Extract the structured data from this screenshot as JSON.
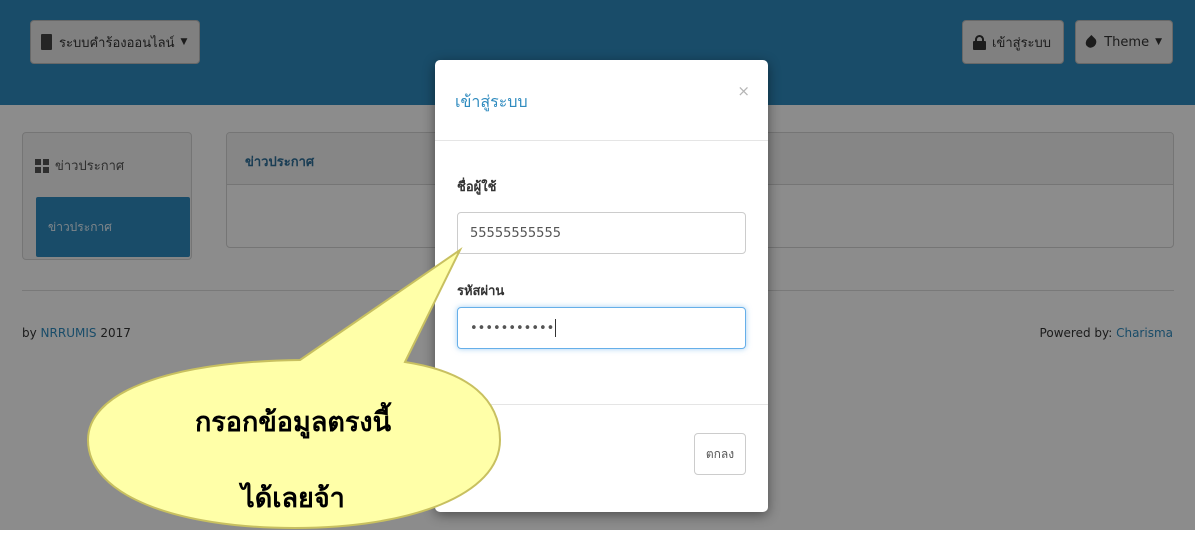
{
  "navbar": {
    "brand_label": "ระบบคำร้องออนไลน์",
    "login_label": "เข้าสู่ระบบ",
    "theme_label": "Theme",
    "color": "#2f8bbf"
  },
  "sidebar": {
    "heading": "ข่าวประกาศ",
    "active_item": "ข่าวประกาศ"
  },
  "main": {
    "panel_title": "ข่าวประกาศ"
  },
  "footer": {
    "prefix": "by ",
    "org_link": "NRRUMIS",
    "year": " 2017",
    "powered_prefix": "Powered by: ",
    "powered_link": "Charisma"
  },
  "modal": {
    "title": "เข้าสู่ระบบ",
    "close_symbol": "×",
    "username_label": "ชื่อผู้ใช้",
    "username_value": "55555555555",
    "password_label": "รหัสผ่าน",
    "password_value": "•••••••••••",
    "ok_label": "ตกลง"
  },
  "callout": {
    "line1": "กรอกข้อมูลตรงนี้",
    "line2": "ได้เลยจ้า",
    "fill": "#ffffa8",
    "stroke": "#c8c060"
  },
  "icons": [
    "book-icon",
    "caret-down-icon",
    "lock-icon",
    "drop-icon",
    "grid-icon",
    "close-icon"
  ]
}
